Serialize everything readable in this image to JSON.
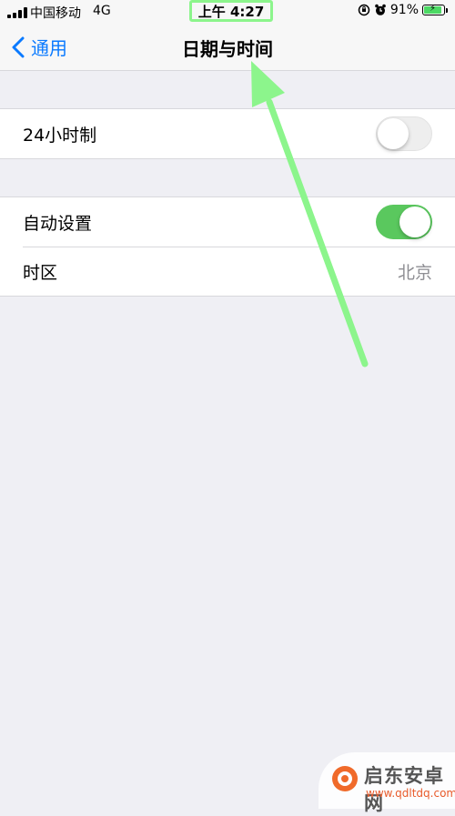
{
  "status_bar": {
    "carrier": "中国移动",
    "network": "4G",
    "time": "上午 4:27",
    "battery_percent": "91%",
    "battery_level": 0.91
  },
  "nav": {
    "back_label": "通用",
    "title": "日期与时间"
  },
  "settings": {
    "group1": {
      "hour24_label": "24小时制",
      "hour24_enabled": false
    },
    "group2": {
      "auto_label": "自动设置",
      "auto_enabled": true,
      "timezone_label": "时区",
      "timezone_value": "北京"
    }
  },
  "watermark": {
    "name": "启东安卓网",
    "url": "www.qdltdq.com"
  },
  "colors": {
    "accent": "#0a7aff",
    "toggle_on": "#5ac85e",
    "annotation": "#8cf58c",
    "background": "#efeff4"
  }
}
